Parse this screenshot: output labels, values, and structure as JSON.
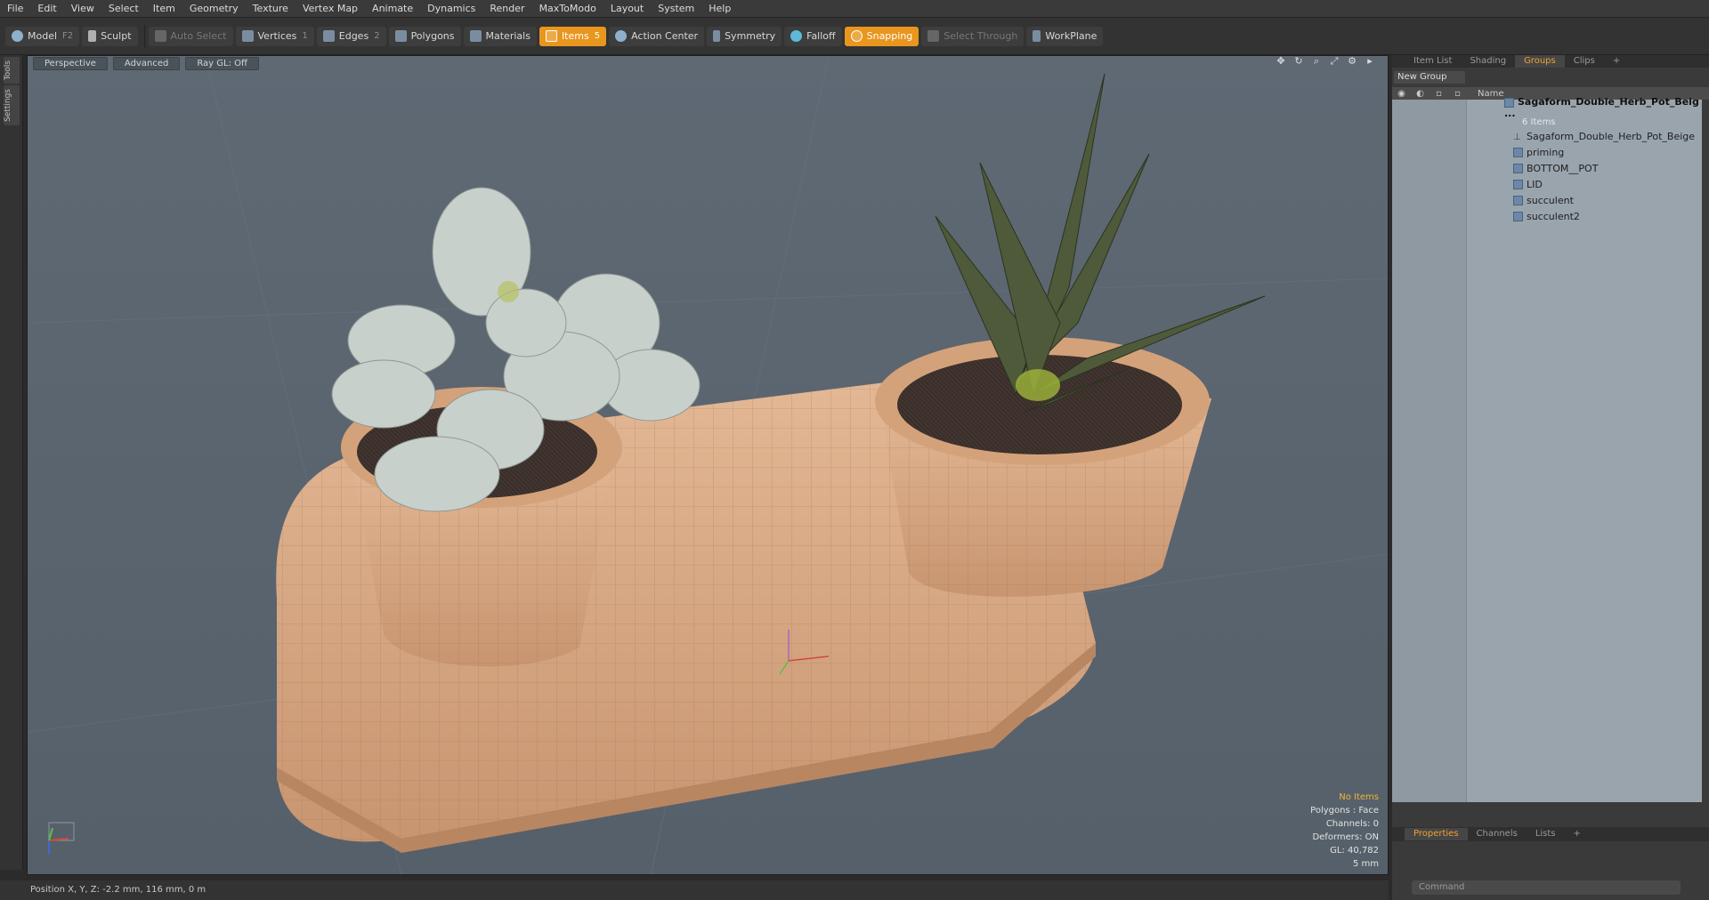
{
  "menu": [
    "File",
    "Edit",
    "View",
    "Select",
    "Item",
    "Geometry",
    "Texture",
    "Vertex Map",
    "Animate",
    "Dynamics",
    "Render",
    "MaxToModo",
    "Layout",
    "System",
    "Help"
  ],
  "toolbar": {
    "model": "Model",
    "model_key": "F2",
    "sculpt": "Sculpt",
    "auto_select": "Auto Select",
    "vertices": "Vertices",
    "vertices_key": "1",
    "edges": "Edges",
    "edges_key": "2",
    "polygons": "Polygons",
    "materials": "Materials",
    "items": "Items",
    "items_key": "5",
    "action_center": "Action Center",
    "symmetry": "Symmetry",
    "falloff": "Falloff",
    "snapping": "Snapping",
    "select_through": "Select Through",
    "workplane": "WorkPlane"
  },
  "left_tabs": [
    "Tools",
    "Settings"
  ],
  "viewport": {
    "view": "Perspective",
    "shading": "Advanced",
    "raygl": "Ray GL: Off",
    "stats": {
      "no_items": "No Items",
      "polygons": "Polygons : Face",
      "channels": "Channels: 0",
      "deformers": "Deformers: ON",
      "gl": "GL: 40,782",
      "scale": "5 mm"
    }
  },
  "right_panel": {
    "tabs": [
      "Item List",
      "Shading",
      "Groups",
      "Clips"
    ],
    "active_tab": "Groups",
    "new_group": "New Group",
    "column_name": "Name",
    "root": {
      "label": "Sagaform_Double_Herb_Pot_Beig ...",
      "count": "6 Items"
    },
    "children": [
      "Sagaform_Double_Herb_Pot_Beige",
      "priming",
      "BOTTOM__POT",
      "LID",
      "succulent",
      "succulent2"
    ],
    "bottom_tabs": [
      "Properties",
      "Channels",
      "Lists"
    ],
    "command_placeholder": "Command"
  },
  "status": "Position X, Y, Z:   -2.2 mm, 116 mm, 0 m",
  "colors": {
    "accent": "#e8961e",
    "viewport_bg": "#5b6570",
    "pot": "#d4a37c"
  }
}
